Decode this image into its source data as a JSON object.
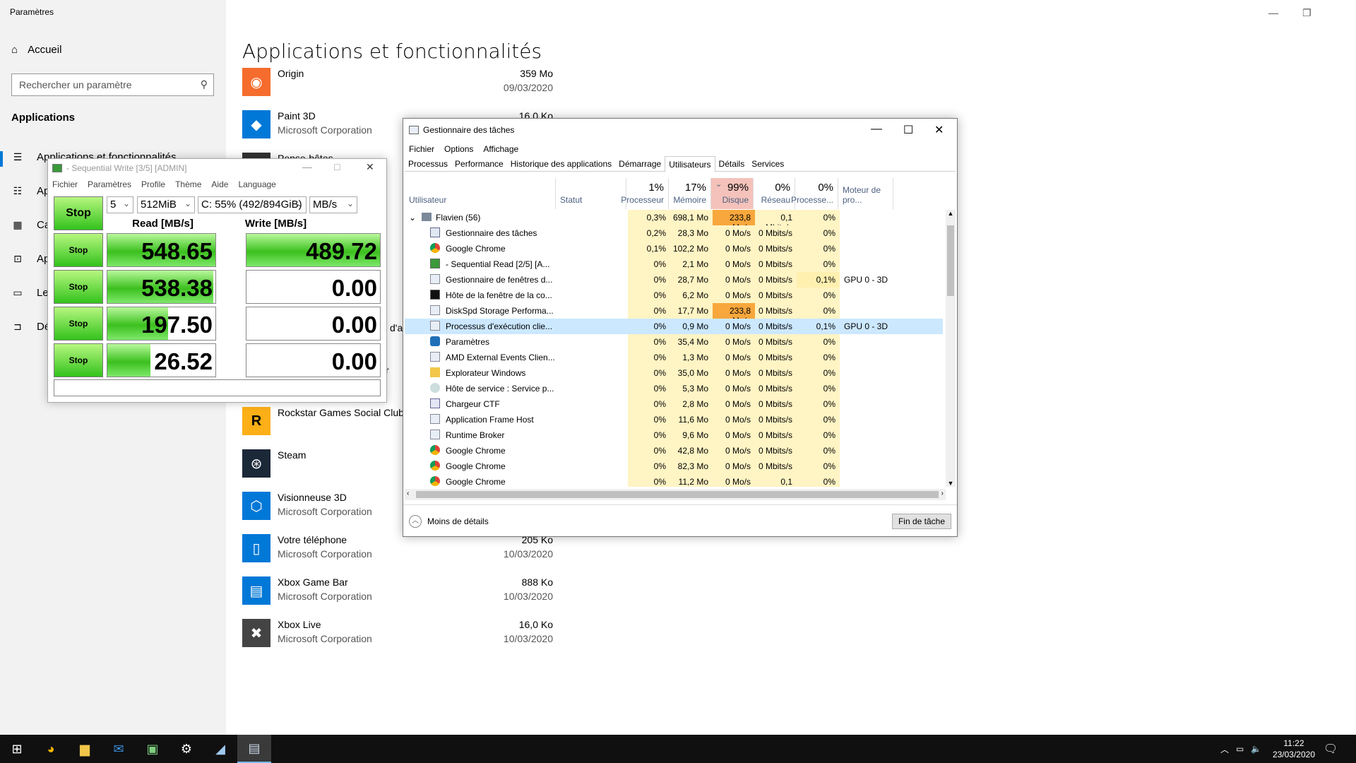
{
  "settings": {
    "window_title": "Paramètres",
    "home_label": "Accueil",
    "search_placeholder": "Rechercher un paramètre",
    "section_label": "Applications",
    "nav_items": [
      {
        "label": "Applications et fonctionnalités",
        "icon": "list-icon"
      },
      {
        "label": "Applications par défaut",
        "icon": "default-apps-icon"
      },
      {
        "label": "Cartes hors connexion",
        "icon": "map-icon"
      },
      {
        "label": "Applications pour les sites web",
        "icon": "web-apps-icon"
      },
      {
        "label": "Lecture vidéo",
        "icon": "video-icon"
      },
      {
        "label": "Démarrage",
        "icon": "startup-icon"
      }
    ],
    "page_title": "Applications et fonctionnalités",
    "apps": [
      {
        "name": "Origin",
        "publisher": "",
        "size": "359 Mo",
        "date": "09/03/2020",
        "color": "#f56c2d",
        "icon": "origin-icon"
      },
      {
        "name": "Paint 3D",
        "publisher": "Microsoft Corporation",
        "size": "16,0 Ko",
        "date": "",
        "color": "#0078d7",
        "icon": "paint3d-icon"
      },
      {
        "name": "Pense-bêtes",
        "publisher": "",
        "size": "",
        "date": "",
        "color": "#333333",
        "icon": "sticky-notes-icon"
      },
      {
        "name": "Rockstar Games Social Club",
        "publisher": "",
        "size": "",
        "date": "",
        "color": "#fcaf17",
        "icon": "rockstar-icon"
      },
      {
        "name": "Steam",
        "publisher": "",
        "size": "",
        "date": "",
        "color": "#1b2838",
        "icon": "steam-icon"
      },
      {
        "name": "Visionneuse 3D",
        "publisher": "Microsoft Corporation",
        "size": "",
        "date": "",
        "color": "#0078d7",
        "icon": "3d-viewer-icon"
      },
      {
        "name": "Votre téléphone",
        "publisher": "Microsoft Corporation",
        "size": "205 Ko",
        "date": "10/03/2020",
        "color": "#0078d7",
        "icon": "phone-icon"
      },
      {
        "name": "Xbox Game Bar",
        "publisher": "Microsoft Corporation",
        "size": "888 Ko",
        "date": "10/03/2020",
        "color": "#0078d7",
        "icon": "xbox-game-bar-icon"
      },
      {
        "name": "Xbox Live",
        "publisher": "Microsoft Corporation",
        "size": "16,0 Ko",
        "date": "10/03/2020",
        "color": "#444444",
        "icon": "xbox-icon"
      }
    ],
    "partial_fragments": {
      "d_a": "d'a",
      "r": "r"
    }
  },
  "cdm": {
    "title": "- Sequential Write [3/5] [ADMIN]",
    "menu": [
      "Fichier",
      "Paramètres",
      "Profile",
      "Thème",
      "Aide",
      "Language"
    ],
    "count": "5",
    "size": "512MiB",
    "drive": "C: 55% (492/894GiB)",
    "unit": "MB/s",
    "all_label": "Stop",
    "read_header": "Read [MB/s]",
    "write_header": "Write [MB/s]",
    "rows": [
      {
        "label": "Stop",
        "read": "548.65",
        "write": "489.72",
        "read_fill": 1.0,
        "write_fill": 1.0
      },
      {
        "label": "Stop",
        "read": "538.38",
        "write": "0.00",
        "read_fill": 0.98,
        "write_fill": 0
      },
      {
        "label": "Stop",
        "read": "197.50",
        "write": "0.00",
        "read_fill": 0.56,
        "write_fill": 0
      },
      {
        "label": "Stop",
        "read": "26.52",
        "write": "0.00",
        "read_fill": 0.4,
        "write_fill": 0
      }
    ]
  },
  "tm": {
    "title": "Gestionnaire des tâches",
    "menu": [
      "Fichier",
      "Options",
      "Affichage"
    ],
    "tabs": [
      "Processus",
      "Performance",
      "Historique des applications",
      "Démarrage",
      "Utilisateurs",
      "Détails",
      "Services"
    ],
    "active_tab": 4,
    "columns": [
      {
        "pct": "",
        "label": "Utilisateur"
      },
      {
        "pct": "",
        "label": "Statut"
      },
      {
        "pct": "1%",
        "label": "Processeur"
      },
      {
        "pct": "17%",
        "label": "Mémoire"
      },
      {
        "pct": "99%",
        "label": "Disque"
      },
      {
        "pct": "0%",
        "label": "Réseau"
      },
      {
        "pct": "0%",
        "label": "Processe..."
      },
      {
        "pct": "",
        "label": "Moteur de pro..."
      }
    ],
    "user_row": {
      "name": "Flavien (56)",
      "cpu": "0,3%",
      "mem": "698,1 Mo",
      "disk": "233,8 Mo/s",
      "net": "0,1 Mbits/s",
      "gpu": "0%",
      "engine": ""
    },
    "processes": [
      {
        "name": "Gestionnaire des tâches",
        "cpu": "0,2%",
        "mem": "28,3 Mo",
        "disk": "0 Mo/s",
        "net": "0 Mbits/s",
        "gpu": "0%",
        "engine": "",
        "icon": "taskmgr-icon"
      },
      {
        "name": "Google Chrome",
        "cpu": "0,1%",
        "mem": "102,2 Mo",
        "disk": "0 Mo/s",
        "net": "0 Mbits/s",
        "gpu": "0%",
        "engine": "",
        "icon": "chrome-icon"
      },
      {
        "name": "- Sequential Read [2/5] [A...",
        "cpu": "0%",
        "mem": "2,1 Mo",
        "disk": "0 Mo/s",
        "net": "0 Mbits/s",
        "gpu": "0%",
        "engine": "",
        "icon": "crystaldiskmark-icon"
      },
      {
        "name": "Gestionnaire de fenêtres d...",
        "cpu": "0%",
        "mem": "28,7 Mo",
        "disk": "0 Mo/s",
        "net": "0 Mbits/s",
        "gpu": "0,1%",
        "engine": "GPU 0 - 3D",
        "icon": "window-icon"
      },
      {
        "name": "Hôte de la fenêtre de la co...",
        "cpu": "0%",
        "mem": "6,2 Mo",
        "disk": "0 Mo/s",
        "net": "0 Mbits/s",
        "gpu": "0%",
        "engine": "",
        "icon": "console-icon"
      },
      {
        "name": "DiskSpd Storage Performa...",
        "cpu": "0%",
        "mem": "17,7 Mo",
        "disk": "233,8 Mo/s",
        "net": "0 Mbits/s",
        "gpu": "0%",
        "engine": "",
        "icon": "window-icon"
      },
      {
        "name": "Processus d'exécution clie...",
        "cpu": "0%",
        "mem": "0,9 Mo",
        "disk": "0 Mo/s",
        "net": "0 Mbits/s",
        "gpu": "0,1%",
        "engine": "GPU 0 - 3D",
        "icon": "window-icon"
      },
      {
        "name": "Paramètres",
        "cpu": "0%",
        "mem": "35,4 Mo",
        "disk": "0 Mo/s",
        "net": "0 Mbits/s",
        "gpu": "0%",
        "engine": "",
        "icon": "settings-gear-icon"
      },
      {
        "name": "AMD External Events Clien...",
        "cpu": "0%",
        "mem": "1,3 Mo",
        "disk": "0 Mo/s",
        "net": "0 Mbits/s",
        "gpu": "0%",
        "engine": "",
        "icon": "window-icon"
      },
      {
        "name": "Explorateur Windows",
        "cpu": "0%",
        "mem": "35,0 Mo",
        "disk": "0 Mo/s",
        "net": "0 Mbits/s",
        "gpu": "0%",
        "engine": "",
        "icon": "folder-icon"
      },
      {
        "name": "Hôte de service : Service p...",
        "cpu": "0%",
        "mem": "5,3 Mo",
        "disk": "0 Mo/s",
        "net": "0 Mbits/s",
        "gpu": "0%",
        "engine": "",
        "icon": "service-gear-icon"
      },
      {
        "name": "Chargeur CTF",
        "cpu": "0%",
        "mem": "2,8 Mo",
        "disk": "0 Mo/s",
        "net": "0 Mbits/s",
        "gpu": "0%",
        "engine": "",
        "icon": "pen-icon"
      },
      {
        "name": "Application Frame Host",
        "cpu": "0%",
        "mem": "11,6 Mo",
        "disk": "0 Mo/s",
        "net": "0 Mbits/s",
        "gpu": "0%",
        "engine": "",
        "icon": "window-icon"
      },
      {
        "name": "Runtime Broker",
        "cpu": "0%",
        "mem": "9,6 Mo",
        "disk": "0 Mo/s",
        "net": "0 Mbits/s",
        "gpu": "0%",
        "engine": "",
        "icon": "window-icon"
      },
      {
        "name": "Google Chrome",
        "cpu": "0%",
        "mem": "42,8 Mo",
        "disk": "0 Mo/s",
        "net": "0 Mbits/s",
        "gpu": "0%",
        "engine": "",
        "icon": "chrome-icon"
      },
      {
        "name": "Google Chrome",
        "cpu": "0%",
        "mem": "82,3 Mo",
        "disk": "0 Mo/s",
        "net": "0 Mbits/s",
        "gpu": "0%",
        "engine": "",
        "icon": "chrome-icon"
      },
      {
        "name": "Google Chrome",
        "cpu": "0%",
        "mem": "11,2 Mo",
        "disk": "0 Mo/s",
        "net": "0,1 Mbits/s",
        "gpu": "0%",
        "engine": "",
        "icon": "chrome-icon"
      }
    ],
    "selected_row": 6,
    "less_details": "Moins de détails",
    "end_task": "Fin de tâche"
  },
  "taskbar": {
    "apps": [
      "windows-start-icon",
      "chrome-icon",
      "file-explorer-icon",
      "mail-icon",
      "crystaldiskmark-icon",
      "settings-gear-icon",
      "notepad-icon",
      "taskmgr-icon"
    ],
    "time": "11:22",
    "date": "23/03/2020"
  },
  "colors": {
    "disk_hot": "#f7a73c",
    "disk_hdr": "#f4c2ba",
    "heat": "#fff4c4",
    "select": "#cce8ff",
    "accent": "#0078d7"
  }
}
